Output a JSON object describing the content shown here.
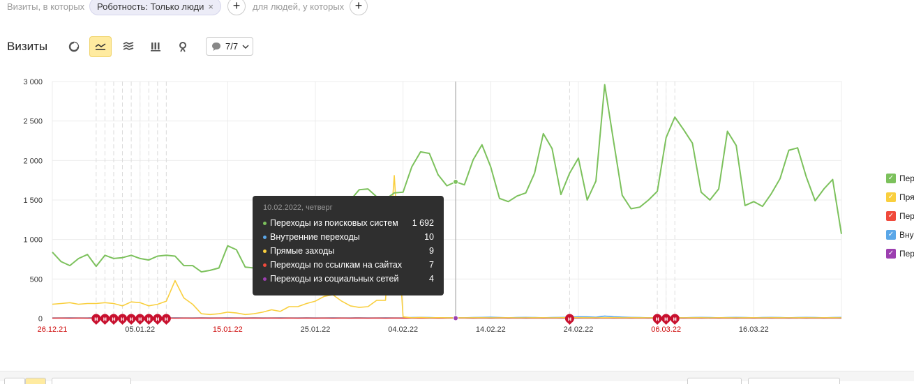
{
  "filter": {
    "prefix": "Визиты, в которых",
    "chip_label": "Роботность: Только люди",
    "chip_remove": "×",
    "add_label": "+",
    "middle_text": "для людей, у которых"
  },
  "header": {
    "title": "Визиты",
    "annotations_label": "7/7"
  },
  "legend": [
    {
      "label": "Пер",
      "color": "#7cc15c",
      "checked": true
    },
    {
      "label": "Пря",
      "color": "#f9cf3e",
      "checked": true
    },
    {
      "label": "Пер",
      "color": "#f04a3c",
      "checked": true
    },
    {
      "label": "Вну",
      "color": "#5aa7e8",
      "checked": true
    },
    {
      "label": "Пер",
      "color": "#9c3fb0",
      "checked": true
    }
  ],
  "tooltip": {
    "date": "10.02.2022, четверг",
    "rows": [
      {
        "name": "Переходы из поисковых систем",
        "value": "1 692",
        "color": "#7cc15c"
      },
      {
        "name": "Внутренние переходы",
        "value": "10",
        "color": "#5aa7e8"
      },
      {
        "name": "Прямые заходы",
        "value": "9",
        "color": "#f9cf3e"
      },
      {
        "name": "Переходы по ссылкам на сайтах",
        "value": "7",
        "color": "#f04a3c"
      },
      {
        "name": "Переходы из социальных сетей",
        "value": "4",
        "color": "#9c3fb0"
      }
    ]
  },
  "chart_data": {
    "type": "line",
    "x_start": "26.12.21",
    "y_ticks": [
      "0",
      "500",
      "1 000",
      "1 500",
      "2 000",
      "2 500",
      "3 000"
    ],
    "ylim": [
      0,
      3000
    ],
    "x_ticks": [
      {
        "label": "26.12.21",
        "index": 0,
        "holiday": true
      },
      {
        "label": "05.01.22",
        "index": 10,
        "holiday": false
      },
      {
        "label": "15.01.22",
        "index": 20,
        "holiday": true
      },
      {
        "label": "25.01.22",
        "index": 30,
        "holiday": false
      },
      {
        "label": "04.02.22",
        "index": 40,
        "holiday": false
      },
      {
        "label": "14.02.22",
        "index": 50,
        "holiday": false
      },
      {
        "label": "24.02.22",
        "index": 60,
        "holiday": false
      },
      {
        "label": "06.03.22",
        "index": 70,
        "holiday": true
      },
      {
        "label": "16.03.22",
        "index": 80,
        "holiday": false
      }
    ],
    "holiday_indices": [
      5,
      6,
      7,
      8,
      9,
      10,
      11,
      12,
      13,
      59,
      69,
      70,
      71
    ],
    "holiday_marker": "н",
    "hover_index": 46,
    "series": [
      {
        "name": "Переходы из поисковых систем",
        "color": "#7cc15c",
        "values": [
          840,
          720,
          670,
          760,
          810,
          660,
          800,
          760,
          770,
          800,
          760,
          740,
          790,
          800,
          790,
          670,
          670,
          590,
          610,
          640,
          920,
          870,
          650,
          640,
          700,
          780,
          820,
          1050,
          1120,
          1280,
          1350,
          1400,
          1480,
          1450,
          1500,
          1630,
          1640,
          1540,
          1510,
          1590,
          1600,
          1920,
          2110,
          2090,
          1820,
          1680,
          1730,
          1692,
          2010,
          2200,
          1920,
          1520,
          1480,
          1550,
          1590,
          1840,
          2340,
          2150,
          1570,
          1840,
          2030,
          1500,
          1740,
          2960,
          2250,
          1560,
          1390,
          1410,
          1500,
          1610,
          2290,
          2550,
          2390,
          2220,
          1600,
          1500,
          1640,
          2370,
          2190,
          1430,
          1480,
          1420,
          1580,
          1770,
          2130,
          2160,
          1790,
          1490,
          1640,
          1760,
          1070
        ]
      },
      {
        "name": "Прямые заходы",
        "color": "#f9cf3e",
        "values": [
          180,
          190,
          200,
          180,
          190,
          190,
          200,
          190,
          160,
          210,
          200,
          160,
          180,
          220,
          480,
          260,
          180,
          60,
          50,
          60,
          80,
          70,
          50,
          60,
          80,
          110,
          90,
          150,
          150,
          190,
          220,
          280,
          300,
          220,
          160,
          140,
          150,
          230,
          230,
          1810,
          20,
          10,
          12,
          10,
          11,
          10,
          9,
          9,
          10,
          10,
          9,
          8,
          10,
          9,
          9,
          10,
          10,
          9,
          10,
          12,
          10,
          10,
          9,
          10,
          10,
          9,
          10,
          10,
          9,
          10,
          10,
          10,
          9,
          10,
          10,
          9,
          10,
          10,
          9,
          10,
          10,
          9,
          10,
          10,
          9,
          10,
          10,
          9,
          10,
          10,
          9
        ]
      },
      {
        "name": "Переходы по ссылкам на сайтах",
        "color": "#f04a3c",
        "values": [
          5,
          6,
          5,
          6,
          5,
          6,
          5,
          6,
          5,
          6,
          5,
          6,
          5,
          6,
          5,
          6,
          5,
          6,
          5,
          6,
          5,
          6,
          5,
          6,
          5,
          6,
          5,
          6,
          5,
          6,
          5,
          6,
          5,
          6,
          5,
          6,
          5,
          6,
          5,
          6,
          5,
          6,
          5,
          6,
          5,
          6,
          7,
          7,
          6,
          7,
          6,
          8,
          7,
          6,
          7,
          6,
          7,
          6,
          7,
          8,
          7,
          6,
          7,
          6,
          7,
          6,
          7,
          6,
          7,
          6,
          7,
          6,
          7,
          6,
          7,
          6,
          7,
          6,
          7,
          6,
          7,
          6,
          7,
          6,
          7,
          6,
          7,
          6,
          7,
          6,
          7
        ]
      },
      {
        "name": "Внутренние переходы",
        "color": "#5aa7e8",
        "values": [
          8,
          9,
          10,
          8,
          9,
          10,
          8,
          9,
          10,
          8,
          9,
          10,
          8,
          9,
          10,
          8,
          9,
          10,
          8,
          9,
          10,
          8,
          9,
          10,
          8,
          9,
          10,
          8,
          9,
          10,
          8,
          9,
          10,
          8,
          9,
          10,
          8,
          9,
          10,
          8,
          9,
          12,
          14,
          12,
          10,
          11,
          10,
          10,
          12,
          14,
          16,
          12,
          10,
          12,
          14,
          12,
          10,
          12,
          14,
          18,
          22,
          20,
          16,
          30,
          22,
          18,
          14,
          12,
          10,
          12,
          14,
          12,
          10,
          12,
          14,
          12,
          10,
          12,
          14,
          12,
          10,
          12,
          14,
          12,
          10,
          12,
          14,
          12,
          10,
          12,
          14
        ]
      },
      {
        "name": "Переходы из социальных сетей",
        "color": "#9c3fb0",
        "values": [
          3,
          4,
          3,
          4,
          3,
          4,
          3,
          4,
          3,
          4,
          3,
          4,
          3,
          4,
          3,
          4,
          3,
          4,
          3,
          4,
          3,
          4,
          3,
          4,
          3,
          4,
          3,
          4,
          3,
          4,
          3,
          4,
          3,
          4,
          3,
          4,
          3,
          4,
          3,
          4,
          3,
          4,
          3,
          4,
          3,
          4,
          4,
          4,
          3,
          4,
          3,
          4,
          3,
          4,
          3,
          4,
          3,
          4,
          3,
          4,
          3,
          4,
          3,
          4,
          3,
          4,
          3,
          4,
          3,
          4,
          3,
          4,
          3,
          4,
          3,
          4,
          3,
          4,
          3,
          4,
          3,
          4,
          3,
          4,
          3,
          4,
          3,
          4,
          3,
          4,
          3
        ]
      }
    ]
  }
}
